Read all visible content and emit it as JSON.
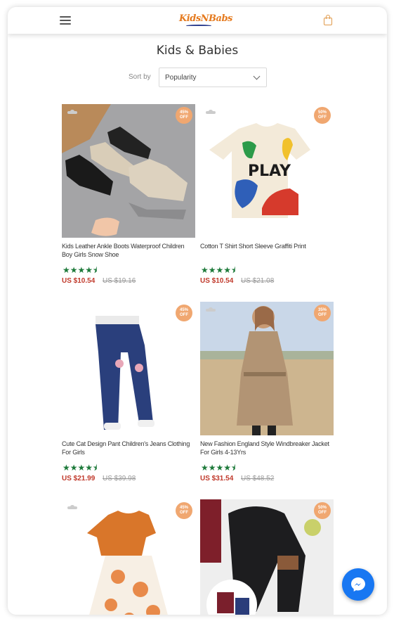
{
  "header": {
    "logo_text": "KidsNBabs",
    "menu_icon": "hamburger-menu-icon",
    "cart_icon": "shopping-bag-icon"
  },
  "page": {
    "title": "Kids & Babies"
  },
  "sort": {
    "label": "Sort by",
    "value": "Popularity"
  },
  "colors": {
    "price": "#c0392b",
    "stars": "#1d7a3a",
    "badge": "#f0a770",
    "messenger": "#1877f2"
  },
  "products": [
    {
      "name": "Kids Leather Ankle Boots Waterproof Children Boy Girls Snow Shoe",
      "price": "US $10.54",
      "old_price": "US $19.16",
      "rating": 4.5,
      "stars": "★★★★⯨",
      "badge_pct": "45%",
      "badge_off": "OFF"
    },
    {
      "name": "Cotton T Shirt Short Sleeve Graffiti Print",
      "price": "US $10.54",
      "old_price": "US $21.08",
      "rating": 4.5,
      "stars": "★★★★⯨",
      "badge_pct": "50%",
      "badge_off": "OFF"
    },
    {
      "name": "Cute Cat Design Pant Children's Jeans Clothing For Girls",
      "price": "US $21.99",
      "old_price": "US $39.98",
      "rating": 4.5,
      "stars": "★★★★⯨",
      "badge_pct": "45%",
      "badge_off": "OFF"
    },
    {
      "name": "New Fashion England Style Windbreaker Jacket For Girls 4-13Yrs",
      "price": "US $31.54",
      "old_price": "US $48.52",
      "rating": 4.5,
      "stars": "★★★★⯨",
      "badge_pct": "35%",
      "badge_off": "OFF"
    },
    {
      "name": "",
      "price": "",
      "old_price": "",
      "rating": null,
      "stars": "",
      "badge_pct": "45%",
      "badge_off": "OFF"
    },
    {
      "name": "",
      "price": "",
      "old_price": "",
      "rating": null,
      "stars": "",
      "badge_pct": "50%",
      "badge_off": "OFF"
    }
  ],
  "messenger": {
    "icon": "messenger-icon"
  }
}
